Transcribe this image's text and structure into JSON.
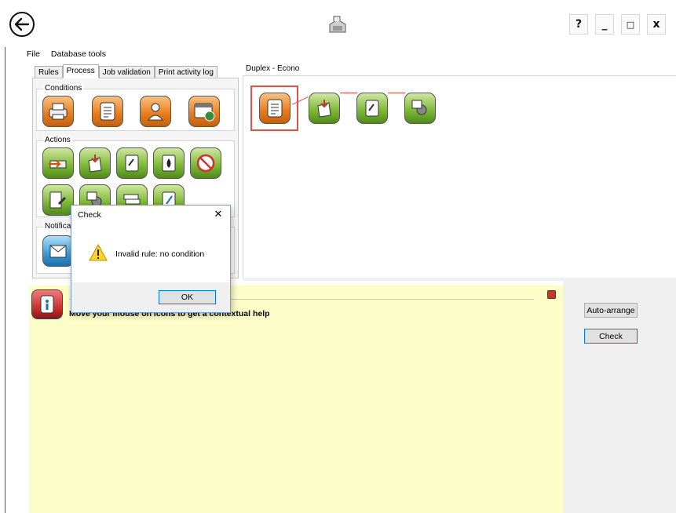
{
  "titlebar": {
    "help_label": "?",
    "minimize_label": "_",
    "maximize_label": "□",
    "close_label": "x"
  },
  "menu": [
    "File",
    "Database tools"
  ],
  "tabs": [
    {
      "label": "Rules",
      "active": false
    },
    {
      "label": "Process",
      "active": true
    },
    {
      "label": "Job validation",
      "active": false
    },
    {
      "label": "Print activity log",
      "active": false
    }
  ],
  "groups": {
    "conditions_title": "Conditions",
    "actions_title": "Actions",
    "notifications_title": "Notificati"
  },
  "workflow": {
    "title": "Duplex - Econo"
  },
  "help": {
    "text": "Move your mouse on icons to get a contextual help"
  },
  "buttons": {
    "auto_arrange": "Auto-arrange",
    "check": "Check"
  },
  "dialog": {
    "title": "Check",
    "message": "Invalid rule: no condition",
    "ok_label": "OK",
    "close_label": "✕"
  },
  "colors": {
    "orange": "#e87b1c",
    "green": "#7bb634",
    "help_bg": "#fdfdc9",
    "selection": "#d9534f"
  }
}
